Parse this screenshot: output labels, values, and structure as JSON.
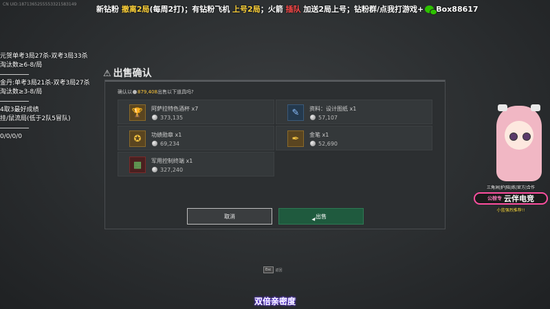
{
  "uid": "CN UID:1871365255553321583149",
  "banner": {
    "p1": "新钻粉 ",
    "p2": "撤离2局",
    "p3": "(每周2打)；有钻粉飞机 ",
    "p4": "上号2局",
    "p5": "；火箭 ",
    "p6": "插队",
    "p7": " 加送2局上号；钻粉群/点我打游戏+",
    "p8": "Box88617"
  },
  "left_info": [
    "元贺单考3局27杀-双考3局33杀",
    "淘汰数≥6-8/局",
    "金丹:单考3局21杀-双考3局27杀",
    "淘汰数≥3-8/局",
    "4取3最好成绩",
    "挂/鼠流局(低于2队5冒队)",
    "0/0/0/0"
  ],
  "dialog": {
    "title": "出售确认",
    "question_prefix": "确认以",
    "amount": "879,408",
    "question_suffix": "出售以下道具吗?",
    "items": [
      {
        "name": "阿萨拉特色酒杯 x7",
        "price": "373,135",
        "icon": "goblet-icon"
      },
      {
        "name": "资料：设计图纸 x1",
        "price": "57,107",
        "icon": "blueprint-icon"
      },
      {
        "name": "功绩勋章 x1",
        "price": "69,234",
        "icon": "medal-icon"
      },
      {
        "name": "金笔 x1",
        "price": "52,690",
        "icon": "gold-pen-icon"
      },
      {
        "name": "军用控制终端 x1",
        "price": "327,240",
        "icon": "terminal-icon"
      }
    ],
    "cancel_label": "取消",
    "confirm_label": "出售"
  },
  "hint": {
    "key": "Esc",
    "label": "返回"
  },
  "subtitle": "双倍亲密度",
  "brand": {
    "top": "三角洲|护|陪|练|官方|合作",
    "prefix": "公棕专",
    "main": "云伴电竞",
    "bottom": "小蓝强烈推荐!!"
  }
}
